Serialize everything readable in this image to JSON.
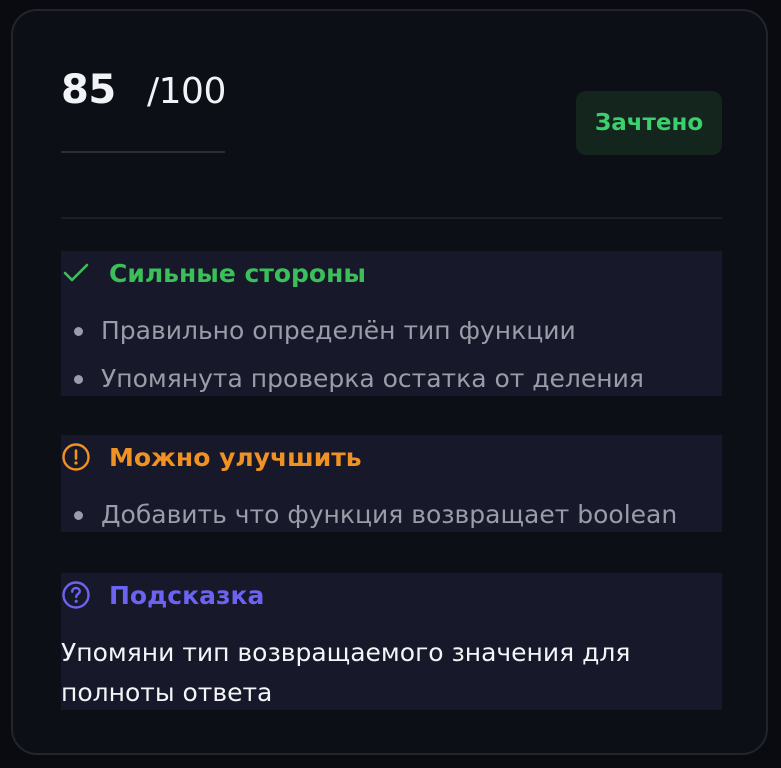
{
  "score": {
    "value": "85",
    "max": "/100"
  },
  "status": {
    "label": "Зачтено",
    "color": "#3ccf6d"
  },
  "strengths": {
    "title": "Сильные стороны",
    "icon": "check-icon",
    "color": "#3bbf59",
    "items": [
      "Правильно определён тип функции",
      "Упомянута проверка остатка от деления"
    ]
  },
  "improvements": {
    "title": "Можно улучшить",
    "icon": "alert-circle-icon",
    "color": "#f09223",
    "items": [
      "Добавить что функция возвращает boolean"
    ]
  },
  "hint": {
    "title": "Подсказка",
    "icon": "help-circle-icon",
    "color": "#6c63f2",
    "text": "Упомяни тип возвращаемого значения для полноты ответа"
  }
}
